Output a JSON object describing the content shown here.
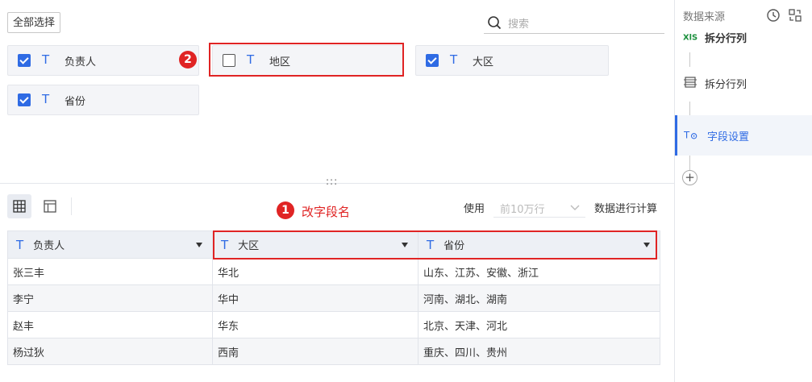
{
  "toolbar": {
    "select_all_label": "全部选择",
    "search_placeholder": "搜索"
  },
  "fields": [
    {
      "label": "负责人",
      "checked": true
    },
    {
      "label": "地区",
      "checked": false
    },
    {
      "label": "大区",
      "checked": true
    },
    {
      "label": "省份",
      "checked": true
    }
  ],
  "annotations": {
    "badge_1": "1",
    "badge_2": "2",
    "rename_hint": "改字段名"
  },
  "preview": {
    "use_label": "使用",
    "rows_option": "前10万行",
    "calc_label": "数据进行计算",
    "splitter_glyph": ":::"
  },
  "table": {
    "columns": [
      "负责人",
      "大区",
      "省份"
    ],
    "rows": [
      [
        "张三丰",
        "华北",
        "山东、江苏、安徽、浙江"
      ],
      [
        "李宁",
        "华中",
        "河南、湖北、湖南"
      ],
      [
        "赵丰",
        "华东",
        "北京、天津、河北"
      ],
      [
        "杨过狄",
        "西南",
        "重庆、四川、贵州"
      ]
    ]
  },
  "side_panel": {
    "title": "数据来源",
    "steps": [
      {
        "label": "拆分行列",
        "icon": "xls-icon"
      },
      {
        "label": "拆分行列",
        "icon": "split-rows-icon"
      },
      {
        "label": "字段设置",
        "icon": "field-settings-icon"
      }
    ],
    "add_label": "+"
  },
  "colors": {
    "accent": "#2f6be4",
    "annotation_red": "#e02424"
  }
}
